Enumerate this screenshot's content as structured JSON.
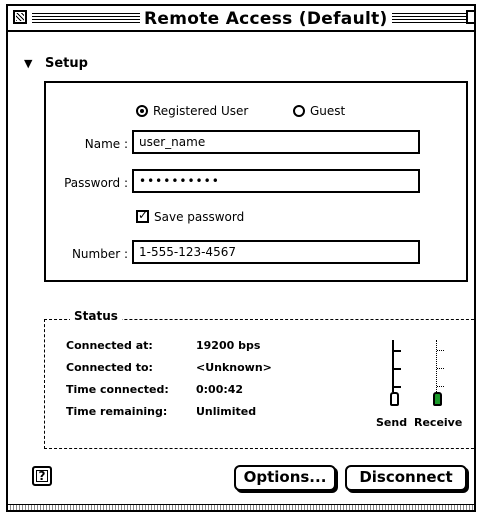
{
  "window": {
    "title": "Remote Access (Default)"
  },
  "setup": {
    "section_label": "Setup",
    "radio_registered": "Registered User",
    "radio_guest": "Guest",
    "selected": "Registered User",
    "name_label": "Name :",
    "name_value": "user_name",
    "password_label": "Password :",
    "password_value": "••••••••••",
    "save_password_label": "Save password",
    "save_password_checked": true,
    "number_label": "Number :",
    "number_value": "1-555-123-4567"
  },
  "status": {
    "section_label": "Status",
    "rows": [
      {
        "label": "Connected at:",
        "value": "19200 bps"
      },
      {
        "label": "Connected to:",
        "value": "<Unknown>"
      },
      {
        "label": "Time connected:",
        "value": "0:00:42"
      },
      {
        "label": "Time remaining:",
        "value": "Unlimited"
      }
    ],
    "send_label": "Send",
    "receive_label": "Receive",
    "receive_light_color": "#1a9a2a"
  },
  "buttons": {
    "help_label": "?",
    "options_label": "Options...",
    "disconnect_label": "Disconnect"
  }
}
